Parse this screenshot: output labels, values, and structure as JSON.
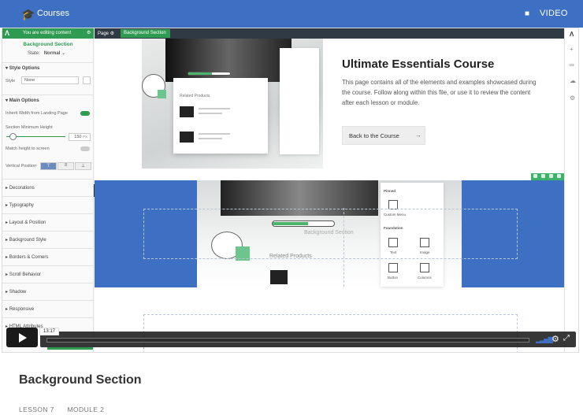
{
  "header": {
    "title": "Courses",
    "cap_icon": "graduation-cap-icon",
    "video_label": "VIDEO",
    "video_icon": "video-camera-icon"
  },
  "editor": {
    "banner": "You are editing content",
    "section_title": "Background Section",
    "state_label": "State:",
    "state_value": "Normal",
    "style_options": "Style Options",
    "style_label": "Style",
    "style_value": "None",
    "main_options": "Main Options",
    "inherit_width": "Inherit Width from Landing Page",
    "section_min_height": "Section Minimum Height",
    "min_height_value": "150",
    "min_height_unit": "PX",
    "match_height": "Match height to screen",
    "vertical_position": "Vertical Position",
    "panels": [
      "Decorations",
      "Typography",
      "Layout & Position",
      "Background Style",
      "Borders & Corners",
      "Scroll Behavior",
      "Shadow",
      "Responsive",
      "HTML Attributes"
    ]
  },
  "breadcrumb": {
    "page": "Page",
    "current": "Background Section"
  },
  "preview": {
    "hero_title": "Ultimate Essentials Course",
    "hero_text": "This page contains all of the elements and examples showcased during the course. Follow along within this file, or use it to review the content after each lesson or module.",
    "hero_button": "Back to the Course",
    "related_products": "Related Products",
    "bg_section_label": "Background Section",
    "panel_items": [
      "Pinned",
      "Custom Menu",
      "Foundation",
      "Text",
      "Image",
      "Button",
      "Columns"
    ]
  },
  "player": {
    "time": "13:17"
  },
  "lesson": {
    "title": "Background Section",
    "lesson": "LESSON 7",
    "module": "MODULE 2"
  }
}
